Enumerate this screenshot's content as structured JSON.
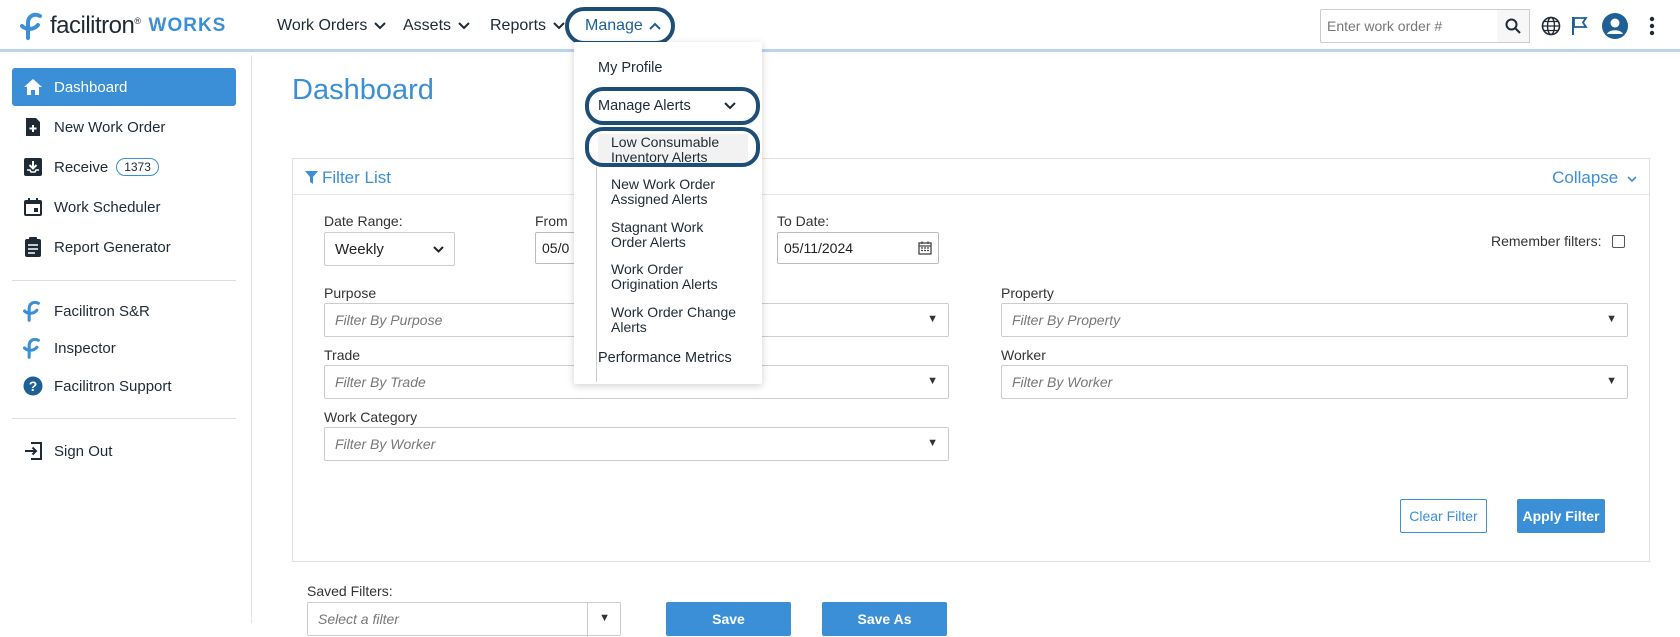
{
  "app": {
    "brand": "facilitron",
    "brand_mark": "®",
    "product": "WORKS"
  },
  "nav": {
    "work_orders": "Work Orders",
    "assets": "Assets",
    "reports": "Reports",
    "manage": "Manage"
  },
  "search": {
    "placeholder": "Enter work order #"
  },
  "sidebar": {
    "dashboard": "Dashboard",
    "new_work_order": "New Work Order",
    "receive": "Receive",
    "receive_count": "1373",
    "work_scheduler": "Work Scheduler",
    "report_generator": "Report Generator",
    "facilitron_sr": "Facilitron S&R",
    "inspector": "Inspector",
    "facilitron_support": "Facilitron Support",
    "sign_out": "Sign Out"
  },
  "main": {
    "title": "Dashboard",
    "filter_title": "Filter List",
    "collapse": "Collapse",
    "date_range_label": "Date Range:",
    "date_range_value": "Weekly",
    "from_label": "From",
    "from_value": "05/0",
    "to_label": "To Date:",
    "to_value": "05/11/2024",
    "remember_label": "Remember filters:",
    "purpose_label": "Purpose",
    "purpose_placeholder": "Filter By Purpose",
    "property_label": "Property",
    "property_placeholder": "Filter By Property",
    "trade_label": "Trade",
    "trade_placeholder": "Filter By Trade",
    "worker_label": "Worker",
    "worker_placeholder": "Filter By Worker",
    "work_category_label": "Work Category",
    "work_category_placeholder": "Filter By Worker",
    "clear_filter": "Clear Filter",
    "apply_filter": "Apply Filter",
    "saved_filters_label": "Saved Filters:",
    "saved_filters_placeholder": "Select a filter",
    "save": "Save",
    "save_as": "Save As"
  },
  "manage_menu": {
    "my_profile": "My Profile",
    "manage_alerts": "Manage Alerts",
    "alerts": [
      "Low Consumable Inventory Alerts",
      "New Work Order Assigned Alerts",
      "Stagnant Work Order Alerts",
      "Work Order Origination Alerts",
      "Work Order Change Alerts"
    ],
    "performance_metrics": "Performance Metrics"
  },
  "colors": {
    "accent": "#3b8fd6",
    "highlight_ring": "#1d4e78",
    "text_dark": "#1e2a36"
  }
}
